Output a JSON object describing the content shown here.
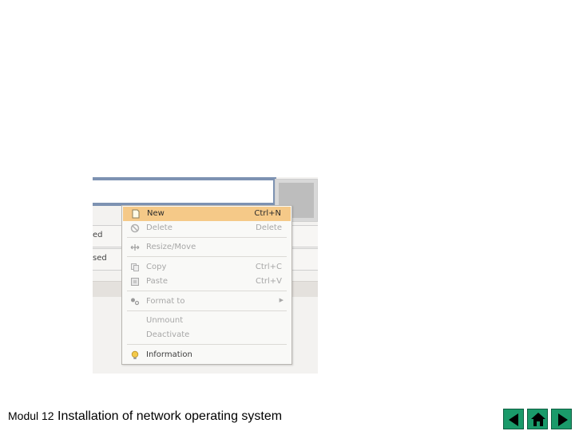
{
  "screenshot": {
    "row1_label": "ed",
    "row2_label": "sed"
  },
  "menu": {
    "items": [
      {
        "label": "New",
        "shortcut": "Ctrl+N",
        "icon": "new-file-icon"
      },
      {
        "label": "Delete",
        "shortcut": "Delete",
        "icon": "delete-icon"
      },
      {
        "label": "Resize/Move",
        "shortcut": "",
        "icon": "resize-move-icon"
      },
      {
        "label": "Copy",
        "shortcut": "Ctrl+C",
        "icon": "copy-icon"
      },
      {
        "label": "Paste",
        "shortcut": "Ctrl+V",
        "icon": "paste-icon"
      },
      {
        "label": "Format to",
        "shortcut": "",
        "icon": "format-icon"
      },
      {
        "label": "Unmount",
        "shortcut": "",
        "icon": ""
      },
      {
        "label": "Deactivate",
        "shortcut": "",
        "icon": ""
      },
      {
        "label": "Information",
        "shortcut": "",
        "icon": "lightbulb-icon"
      }
    ]
  },
  "footer": {
    "module": "Modul 12",
    "title": "Installation of network operating system"
  },
  "nav": {
    "icons": [
      "previous-icon",
      "home-icon",
      "next-icon"
    ],
    "color": "#1a9a6a"
  }
}
